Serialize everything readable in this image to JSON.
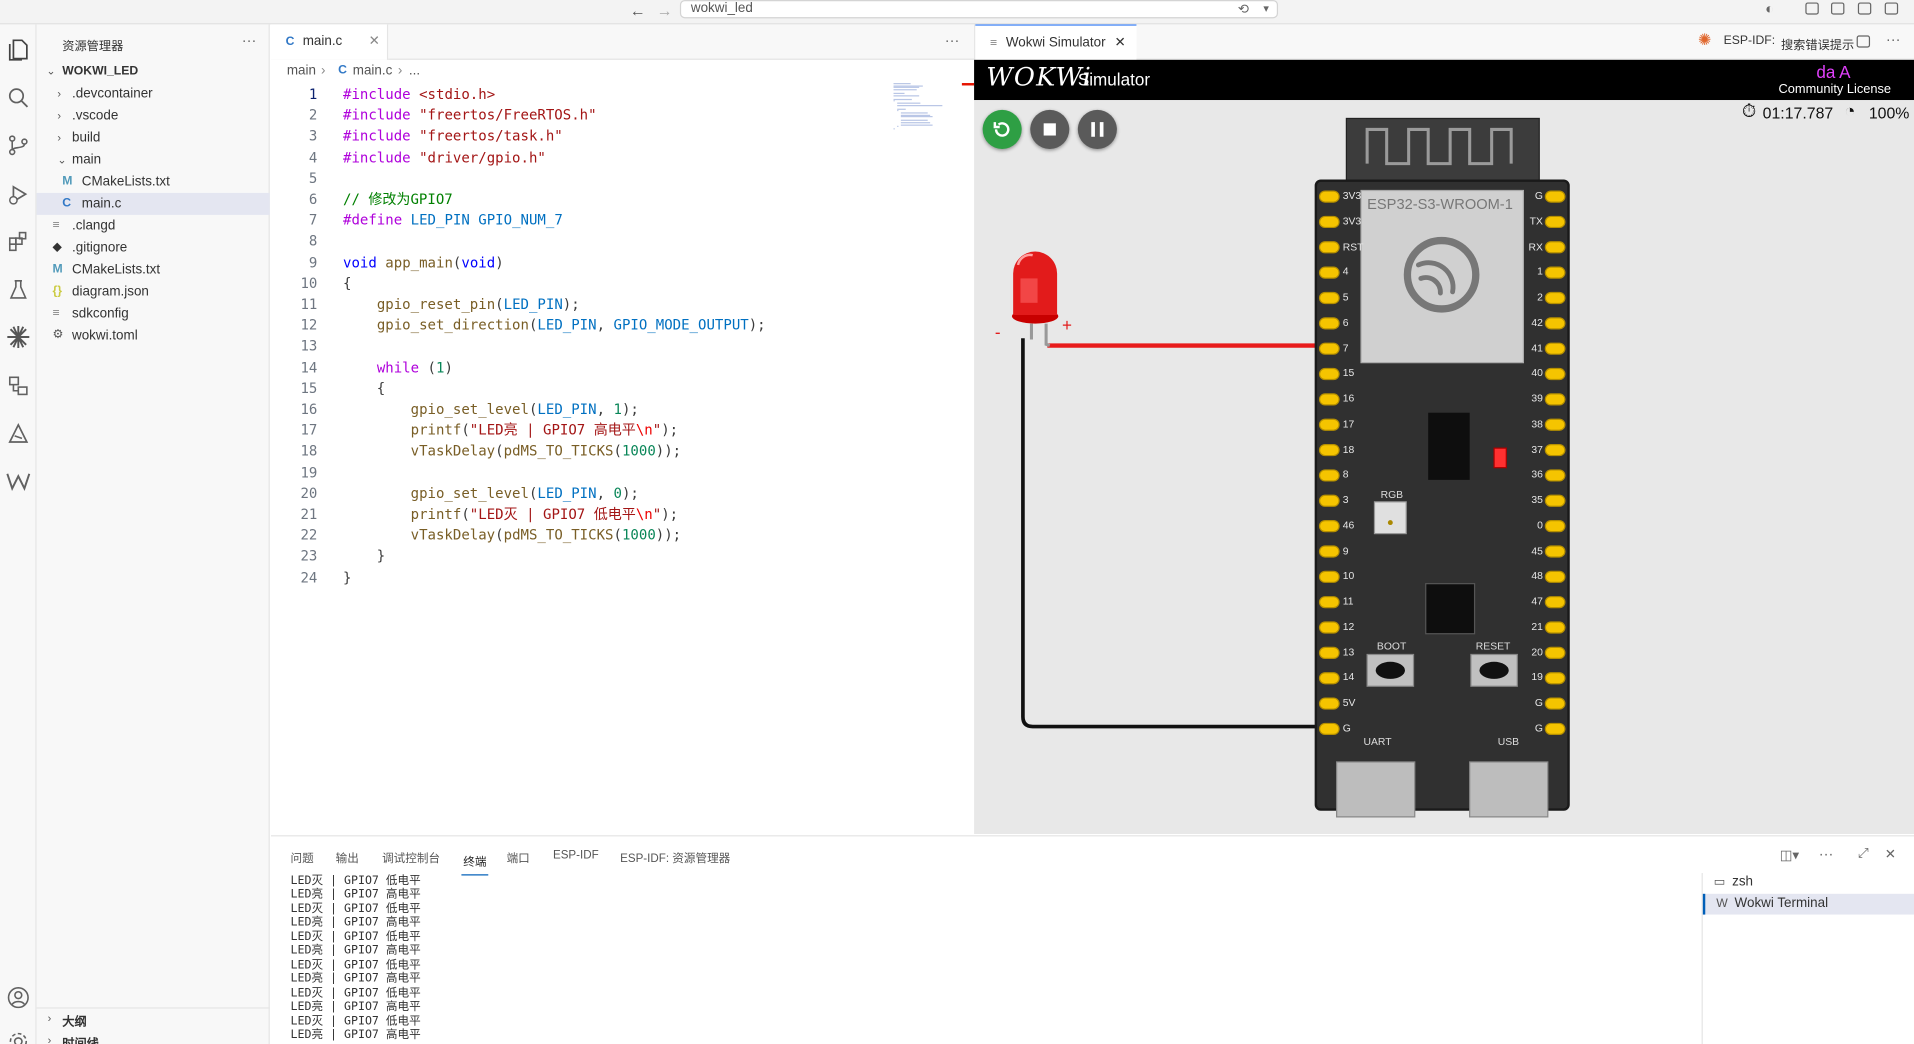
{
  "window": {
    "command_center": "wokwi_led"
  },
  "explorer": {
    "title": "资源管理器",
    "folder": "WOKWI_LED",
    "items": [
      {
        "label": ".devcontainer",
        "icon": "chevron-right-icon"
      },
      {
        "label": ".vscode",
        "icon": "chevron-right-icon"
      },
      {
        "label": "build",
        "icon": "chevron-right-icon"
      },
      {
        "label": "main",
        "icon": "chevron-down-icon"
      },
      {
        "label": "CMakeLists.txt",
        "icon": "M"
      },
      {
        "label": "main.c",
        "icon": "C"
      },
      {
        "label": ".clangd",
        "icon": "≡"
      },
      {
        "label": ".gitignore",
        "icon": "◆"
      },
      {
        "label": "CMakeLists.txt",
        "icon": "M"
      },
      {
        "label": "diagram.json",
        "icon": "{}"
      },
      {
        "label": "sdkconfig",
        "icon": "≡"
      },
      {
        "label": "wokwi.toml",
        "icon": "⚙"
      }
    ],
    "outline": "大纲",
    "timeline": "时间线"
  },
  "editor": {
    "tab": "main.c",
    "breadcrumb": [
      "main",
      "main.c",
      "..."
    ],
    "lines": [
      "#include <stdio.h>",
      "#include \"freertos/FreeRTOS.h\"",
      "#include \"freertos/task.h\"",
      "#include \"driver/gpio.h\"",
      "",
      "// 修改为GPIO7",
      "#define LED_PIN GPIO_NUM_7",
      "",
      "void app_main(void)",
      "{",
      "    gpio_reset_pin(LED_PIN);",
      "    gpio_set_direction(LED_PIN, GPIO_MODE_OUTPUT);",
      "",
      "    while (1)",
      "    {",
      "        gpio_set_level(LED_PIN, 1);",
      "        printf(\"LED亮 | GPIO7 高电平\\n\");",
      "        vTaskDelay(pdMS_TO_TICKS(1000));",
      "",
      "        gpio_set_level(LED_PIN, 0);",
      "        printf(\"LED灭 | GPIO7 低电平\\n\");",
      "        vTaskDelay(pdMS_TO_TICKS(1000));",
      "    }",
      "}"
    ]
  },
  "wokwi": {
    "tab": "Wokwi Simulator",
    "espidf_label": "ESP-IDF:",
    "espidf_hint": "搜索错误提示",
    "logo": "WOKWi",
    "subtitle": "Simulator",
    "user": "da A",
    "license": "Community License",
    "timer": "01:17.787",
    "speed": "100%",
    "board_name": "ESP32-S3-WROOM-1",
    "rgb_label": "RGB",
    "boot_label": "BOOT",
    "reset_label": "RESET",
    "uart_label": "UART",
    "usb_label": "USB",
    "led_minus": "-",
    "led_plus": "+",
    "left_pins": [
      "3V3",
      "3V3",
      "RST",
      "4",
      "5",
      "6",
      "7",
      "15",
      "16",
      "17",
      "18",
      "8",
      "3",
      "46",
      "9",
      "10",
      "11",
      "12",
      "13",
      "14",
      "5V",
      "G"
    ],
    "right_pins": [
      "G",
      "TX",
      "RX",
      "1",
      "2",
      "42",
      "41",
      "40",
      "39",
      "38",
      "37",
      "36",
      "35",
      "0",
      "45",
      "48",
      "47",
      "21",
      "20",
      "19",
      "G",
      "G"
    ]
  },
  "panel": {
    "tabs": [
      "问题",
      "输出",
      "调试控制台",
      "终端",
      "端口",
      "ESP-IDF",
      "ESP-IDF: 资源管理器"
    ],
    "active_tab": "终端",
    "terminal_lines": [
      "LED灭 | GPIO7 低电平",
      "LED亮 | GPIO7 高电平",
      "LED灭 | GPIO7 低电平",
      "LED亮 | GPIO7 高电平",
      "LED灭 | GPIO7 低电平",
      "LED亮 | GPIO7 高电平",
      "LED灭 | GPIO7 低电平",
      "LED亮 | GPIO7 高电平",
      "LED灭 | GPIO7 低电平",
      "LED亮 | GPIO7 高电平",
      "LED灭 | GPIO7 低电平",
      "LED亮 | GPIO7 高电平"
    ],
    "terminals": [
      "zsh",
      "Wokwi Terminal"
    ]
  },
  "colors": {
    "accent": "#005fb8",
    "wire_red": "#e81b1b",
    "pin_yellow": "#f5c400",
    "board": "#303030"
  }
}
